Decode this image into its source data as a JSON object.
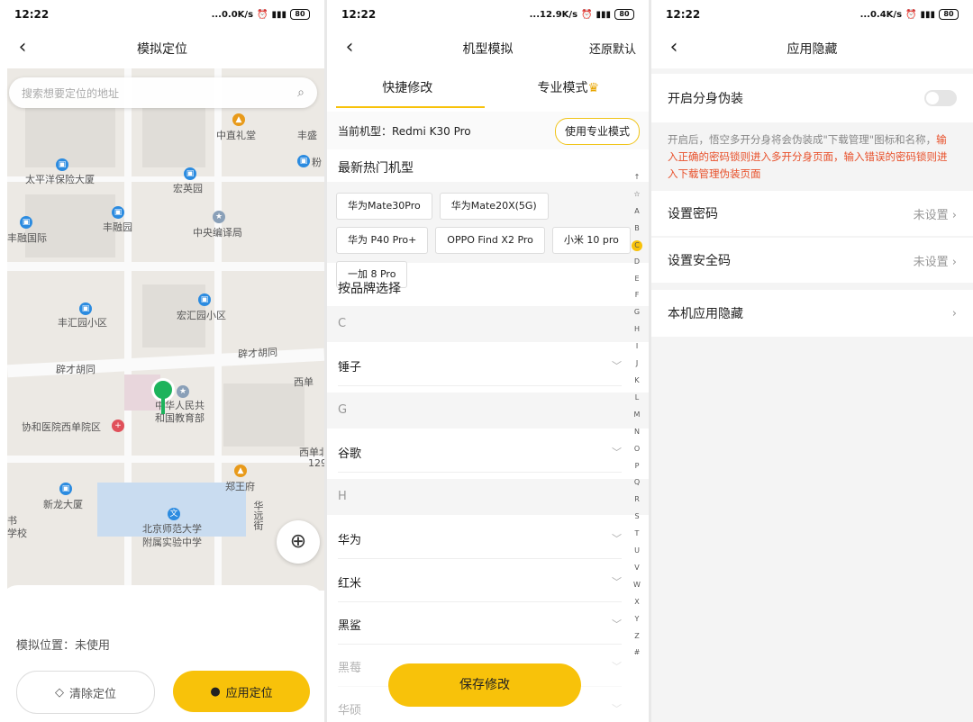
{
  "status": [
    {
      "time": "12:22",
      "net": "...0.0K/s",
      "battery": "80"
    },
    {
      "time": "12:22",
      "net": "...12.9K/s",
      "battery": "80"
    },
    {
      "time": "12:22",
      "net": "...0.4K/s",
      "battery": "80"
    }
  ],
  "screen1": {
    "title": "模拟定位",
    "search_placeholder": "搜索想要定位的地址",
    "pois": [
      "中直礼堂",
      "丰盛",
      "太平洋保险大厦",
      "宏英园",
      "丰融园",
      "中央编译局",
      "丰融国际",
      "丰汇园小区",
      "宏汇园小区",
      "辟才胡同",
      "辟才胡同",
      "西单",
      "中华人民共",
      "和国教育部",
      "协和医院西单院区",
      "西单北",
      "129",
      "郑王府",
      "新龙大厦",
      "北京师范大学",
      "附属实验中学",
      "华远街",
      "书",
      "学校",
      "粉"
    ],
    "sim_status": "模拟位置：未使用",
    "clear_label": "清除定位",
    "apply_label": "应用定位"
  },
  "screen2": {
    "title": "机型模拟",
    "reset": "还原默认",
    "tab_quick": "快捷修改",
    "tab_pro": "专业模式",
    "current_model": "当前机型：Redmi K30 Pro",
    "use_pro": "使用专业模式",
    "hot_title": "最新热门机型",
    "hot": [
      "华为Mate30Pro",
      "华为Mate20X(5G)",
      "华为 P40 Pro+",
      "OPPO Find X2 Pro",
      "小米 10 pro",
      "一加 8 Pro"
    ],
    "brand_title": "按品牌选择",
    "letters": [
      "C",
      "G",
      "H"
    ],
    "brands": [
      "锤子",
      "谷歌",
      "华为",
      "红米",
      "黑鲨",
      "黑莓",
      "华硕"
    ],
    "index": [
      "↑",
      "☆",
      "A",
      "B",
      "C",
      "D",
      "E",
      "F",
      "G",
      "H",
      "I",
      "J",
      "K",
      "L",
      "M",
      "N",
      "O",
      "P",
      "Q",
      "R",
      "S",
      "T",
      "U",
      "V",
      "W",
      "X",
      "Y",
      "Z",
      "#"
    ],
    "save": "保存修改"
  },
  "screen3": {
    "title": "应用隐藏",
    "toggle_label": "开启分身伪装",
    "desc_plain": "开启后，悟空多开分身将会伪装成\"下载管理\"图标和名称，",
    "desc_warn": "输入正确的密码锁则进入多开分身页面，输入错误的密码锁则进入下载管理伪装页面",
    "set_password": "设置密码",
    "set_password_val": "未设置",
    "set_security": "设置安全码",
    "set_security_val": "未设置",
    "local_hide": "本机应用隐藏"
  }
}
